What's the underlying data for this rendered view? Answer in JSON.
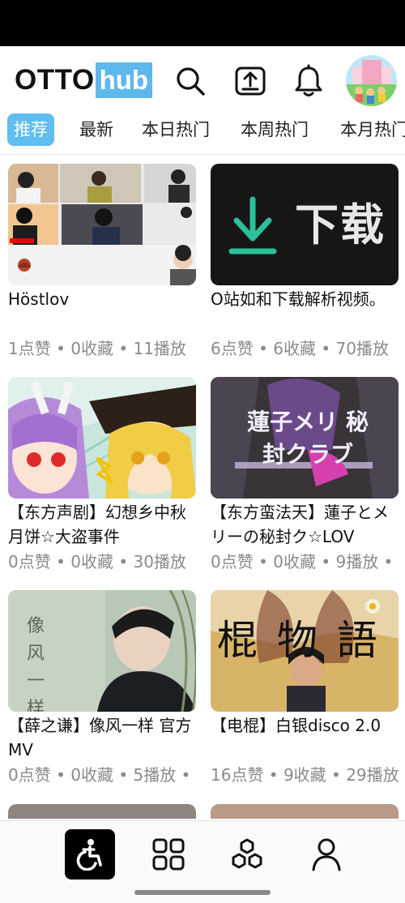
{
  "app": {
    "logo_left": "OTTO",
    "logo_right": "hub"
  },
  "header": {
    "icons": [
      "search-icon",
      "upload-icon",
      "bell-icon"
    ],
    "avatar": "avatar"
  },
  "tabs": [
    {
      "label": "推荐",
      "active": true
    },
    {
      "label": "最新",
      "active": false
    },
    {
      "label": "本日热门",
      "active": false
    },
    {
      "label": "本周热门",
      "active": false
    },
    {
      "label": "本月热门",
      "active": false
    }
  ],
  "videos": [
    {
      "title": "Höstlov",
      "stats": "1点赞 • 0收藏 • 11播放"
    },
    {
      "title": "O站如和下载解析视频。",
      "stats": "6点赞 • 6收藏 • 70播放",
      "thumb_text": "下载"
    },
    {
      "title": "【东方声剧】幻想乡中秋月饼☆大盗事件",
      "stats": "0点赞 • 0收藏 • 30播放"
    },
    {
      "title": "【东方蛮法天】蓮子とメリーの秘封ク☆LOV",
      "stats": "0点赞 • 0收藏 • 9播放 •",
      "thumb_text": "蓮子メリ 秘封クラブ"
    },
    {
      "title": "【薛之谦】像风一样 官方MV",
      "stats": "0点赞 • 0收藏 • 5播放 •",
      "thumb_text": "像 风 一样"
    },
    {
      "title": "【电棍】白银disco 2.0",
      "stats": "16点赞 • 9收藏 • 29播放",
      "thumb_text": "棍 物 語"
    }
  ],
  "bottom_nav": [
    {
      "name": "accessibility-icon",
      "active": true
    },
    {
      "name": "grid-icon",
      "active": false
    },
    {
      "name": "hexagons-icon",
      "active": false
    },
    {
      "name": "user-icon",
      "active": false
    }
  ],
  "colors": {
    "accent": "#5fbdf0",
    "stats_text": "#8a8a8a",
    "download_green": "#2bbf9a"
  }
}
